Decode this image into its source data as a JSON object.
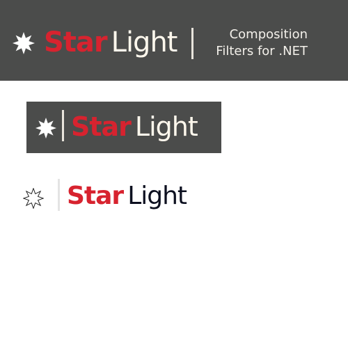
{
  "logos": [
    {
      "brand_part1": "Star",
      "brand_part2": "Light",
      "tagline_line1": "Composition",
      "tagline_line2": "Filters for .NET"
    },
    {
      "brand_part1": "Star",
      "brand_part2": "Light"
    },
    {
      "brand_part1": "Star",
      "brand_part2": "Light"
    }
  ],
  "colors": {
    "red": "#d7232f",
    "cream": "#fdf7ec",
    "dark": "#0d1020",
    "banner": "#4b4c4b"
  }
}
